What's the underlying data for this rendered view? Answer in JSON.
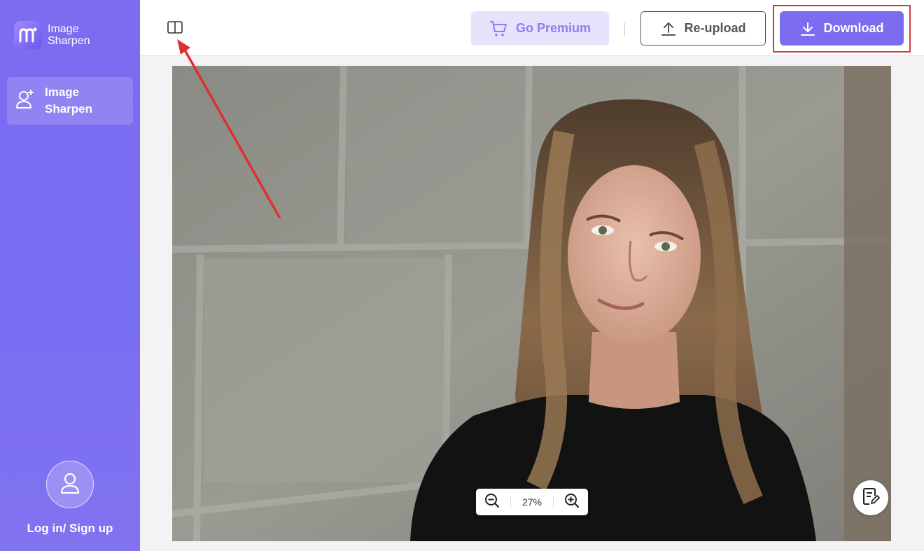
{
  "app": {
    "logo_line1": "Image",
    "logo_line2": "Sharpen"
  },
  "sidebar": {
    "nav_label_line1": "Image",
    "nav_label_line2": "Sharpen",
    "login_label": "Log in/ Sign up"
  },
  "toolbar": {
    "premium_label": "Go Premium",
    "reupload_label": "Re-upload",
    "download_label": "Download"
  },
  "viewer": {
    "zoom_level": "27%"
  },
  "colors": {
    "accent": "#7c6cf0",
    "premium_bg": "#e7e3fd",
    "highlight": "#d43a3a"
  },
  "icons": {
    "logo": "logo-icon",
    "nav": "user-sparkle-icon",
    "avatar": "user-icon",
    "compare": "compare-split-icon",
    "premium": "cart-icon",
    "reupload": "upload-icon",
    "download": "download-icon",
    "zoom_out": "zoom-out-icon",
    "zoom_in": "zoom-in-icon",
    "feedback": "feedback-icon"
  }
}
